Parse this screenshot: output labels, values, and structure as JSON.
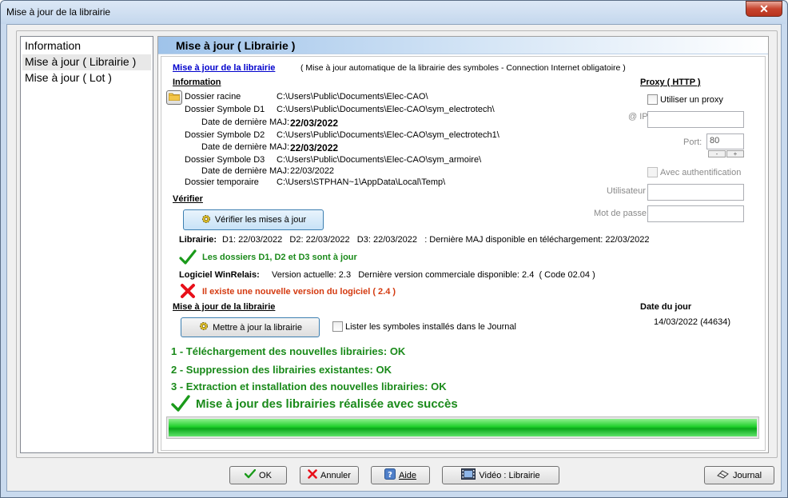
{
  "window": {
    "title": "Mise à jour de la librairie",
    "close_glyph": "✕"
  },
  "sidebar": {
    "items": [
      {
        "label": "Information"
      },
      {
        "label": "Mise à jour ( Librairie )"
      },
      {
        "label": "Mise à jour ( Lot )"
      }
    ]
  },
  "panel": {
    "title": "Mise à jour ( Librairie )",
    "header_link": "Mise à jour de la librairie",
    "header_note": "( Mise à jour automatique de la librairie des symboles - Connection Internet obligatoire )",
    "info_heading": "Information",
    "rows": {
      "root_label": "Dossier racine",
      "root_path": "C:\\Users\\Public\\Documents\\Elec-CAO\\",
      "d1_label": "Dossier Symbole D1",
      "d1_path": "C:\\Users\\Public\\Documents\\Elec-CAO\\sym_electrotech\\",
      "date_label": "Date de dernière MAJ:",
      "d1_date": "22/03/2022",
      "d2_label": "Dossier Symbole D2",
      "d2_path": "C:\\Users\\Public\\Documents\\Elec-CAO\\sym_electrotech1\\",
      "d2_date": "22/03/2022",
      "d3_label": "Dossier Symbole D3",
      "d3_path": "C:\\Users\\Public\\Documents\\Elec-CAO\\sym_armoire\\",
      "d3_date": "22/03/2022",
      "tmp_label": "Dossier temporaire",
      "tmp_path": "C:\\Users\\STPHAN~1\\AppData\\Local\\Temp\\"
    },
    "verify_heading": "Vérifier",
    "verify_button": "Vérifier les mises à jour",
    "library_label": "Librairie:",
    "library_status": "D1: 22/03/2022   D2: 22/03/2022   D3: 22/03/2022   : Dernière MAJ disponible en téléchargement: 22/03/2022",
    "folders_ok": "Les dossiers D1, D2 et D3 sont à jour",
    "software_label": "Logiciel WinRelais:",
    "software_status": "Version actuelle: 2.3   Dernière version commerciale disponible: 2.4  ( Code 02.04 )",
    "new_version": "Il existe une nouvelle version du logiciel ( 2.4 )",
    "update_heading": "Mise à jour de la librairie",
    "update_button": "Mettre à jour la librairie",
    "journal_checkbox": "Lister les symboles installés dans le Journal",
    "date_heading": "Date du jour",
    "date_value": "14/03/2022 (44634)",
    "steps": [
      "1 - Téléchargement des nouvelles librairies: OK",
      "2 - Suppression des librairies existantes: OK",
      "3 - Extraction et installation des nouvelles librairies: OK"
    ],
    "success": "Mise à jour des librairies réalisée avec succès",
    "progress_fraction": 1.0
  },
  "proxy": {
    "heading": "Proxy ( HTTP )",
    "use_proxy": "Utiliser un proxy",
    "ip_label": "@ IP",
    "ip_value": "",
    "port_label": "Port:",
    "port_value": "80",
    "spin_minus": "-",
    "spin_plus": "+",
    "auth_label": "Avec authentification",
    "user_label": "Utilisateur",
    "user_value": "",
    "pass_label": "Mot de passe",
    "pass_value": ""
  },
  "buttons": {
    "ok": "OK",
    "cancel": "Annuler",
    "help": "Aide",
    "video": "Vidéo : Librairie",
    "journal": "Journal"
  },
  "colors": {
    "success": "#1a8a1a",
    "error": "#d43a10",
    "link": "#0000cc",
    "progress": "#1fcf2b"
  },
  "icons": [
    "folder-icon",
    "gear-icon",
    "check-icon",
    "cross-icon",
    "help-icon",
    "film-icon",
    "eraser-icon"
  ]
}
